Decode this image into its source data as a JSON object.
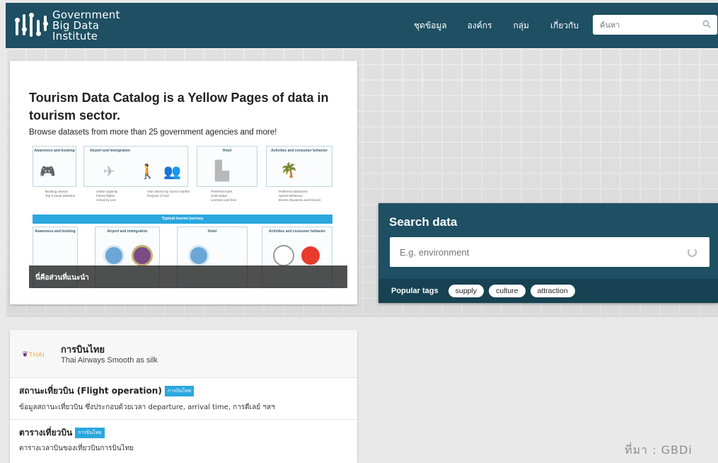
{
  "header": {
    "logo_line1": "Government",
    "logo_line2": "Big Data",
    "logo_line3": "Institute",
    "nav": [
      "ชุดข้อมูล",
      "องค์กร",
      "กลุ่ม",
      "เกี่ยวกับ"
    ],
    "search_placeholder": "ค้นหา",
    "search_icon": "search-icon"
  },
  "feature": {
    "title": "Tourism Data Catalog is a Yellow Pages of data in tourism sector.",
    "subtitle": "Browse datasets from more than 25 government agencies and more!",
    "caption": "นี่คือส่วนที่แนะนำ",
    "infographic": {
      "top_boxes": [
        "Awareness and booking",
        "Airport          and          Immigration",
        "Hotel",
        "Activities and consumer behavior"
      ],
      "bullets": [
        [
          "Booking season",
          "Top 5 travel websites"
        ],
        [
          "Airline capacity",
          "Future flights",
          "Arrival by port"
        ],
        [
          "Visit volume by source market",
          "Purpose of visit"
        ],
        [
          "Preferred hotel",
          "Hotel data2",
          "Licenses and fees"
        ],
        [
          "Preferred attractions",
          "Spend behaviour",
          "Events (business and leisure)"
        ]
      ],
      "band": "Typical tourist journey",
      "bottom_boxes": [
        "Awareness and booking",
        "Airport and immigration",
        "Hotel",
        "Activities and consumer behavior"
      ]
    }
  },
  "search": {
    "title": "Search data",
    "placeholder": "E.g. environment",
    "popular_label": "Popular tags",
    "tags": [
      "supply",
      "culture",
      "attraction"
    ]
  },
  "organization": {
    "logo_text": "THAI",
    "name": "การบินไทย",
    "tagline": "Thai Airways Smooth as silk"
  },
  "datasets": [
    {
      "title": "สถานะเที่ยวบิน (Flight operation)",
      "badge": "การบินไทย",
      "desc": "ข้อมูลสถานะเที่ยวบิน ซึ่งประกอบด้วยเวลา departure, arrival time, การดีเลย์ ฯลฯ"
    },
    {
      "title": "ตารางเที่ยวบิน",
      "badge": "การบินไทย",
      "desc": "ตารางเวลาบินของเที่ยวบินการบินไทย"
    }
  ],
  "source_note": "ที่มา :  GBDi",
  "colors": {
    "brand_navy": "#1e4f63",
    "tags_bar": "#174253",
    "badge_blue": "#29a8df"
  }
}
